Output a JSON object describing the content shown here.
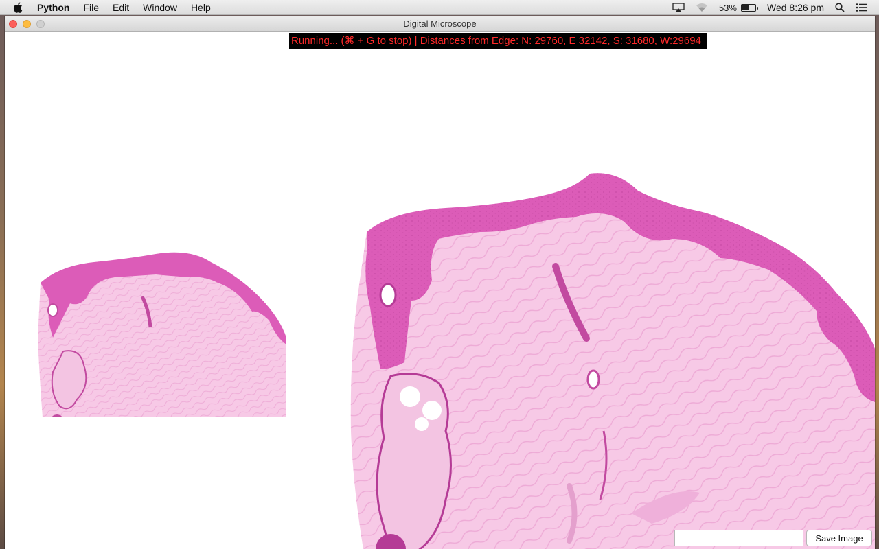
{
  "menubar": {
    "app_name": "Python",
    "items": [
      "File",
      "Edit",
      "Window",
      "Help"
    ],
    "battery_percent_text": "53%",
    "battery_level": 0.53,
    "clock": "Wed 8:26 pm",
    "icons": [
      "apple-icon",
      "airplay-icon",
      "wifi-icon",
      "battery-icon",
      "search-icon",
      "notification-center-icon"
    ]
  },
  "window": {
    "title": "Digital Microscope",
    "status_text": "Running... (⌘ + G to stop) |   Distances from Edge: N: 29760, E 32142, S: 31680, W:29694",
    "save_field_value": "",
    "save_button_label": "Save Image"
  },
  "colors": {
    "status_bg": "#000000",
    "status_text": "#ff2a2a",
    "epidermis": "#dc5cb8",
    "dermis": "#f5bde0"
  }
}
